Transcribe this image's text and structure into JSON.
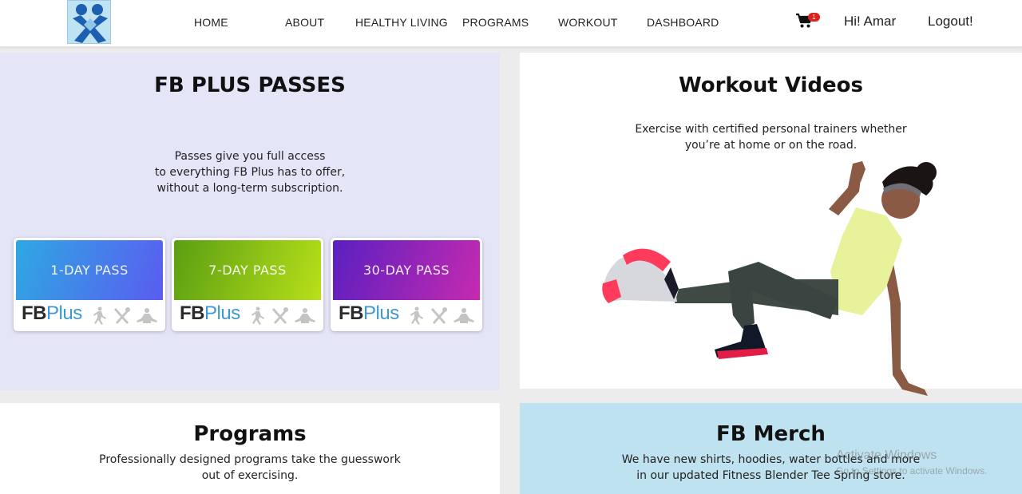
{
  "nav": {
    "links": [
      "HOME",
      "ABOUT",
      "HEALTHY LIVING",
      "PROGRAMS",
      "WORKOUT",
      "DASHBOARD"
    ],
    "cart_count": "1",
    "greeting": "Hi! Amar",
    "logout": "Logout!"
  },
  "passes": {
    "title": "FB PLUS PASSES",
    "description": [
      "Passes give you full access",
      "to everything FB Plus has to offer,",
      "without a long-term subscription."
    ],
    "cards": [
      {
        "label": "1-DAY PASS",
        "brand_fb": "FB",
        "brand_plus": "Plus",
        "gradient": [
          "#2ea8e3",
          "#5a5cf0"
        ]
      },
      {
        "label": "7-DAY PASS",
        "brand_fb": "FB",
        "brand_plus": "Plus",
        "gradient": [
          "#5a9e12",
          "#b8e01a"
        ]
      },
      {
        "label": "30-DAY PASS",
        "brand_fb": "FB",
        "brand_plus": "Plus",
        "gradient": [
          "#5a1fc0",
          "#c62ab0"
        ]
      }
    ]
  },
  "videos": {
    "title": "Workout Videos",
    "description": [
      "Exercise with certified personal trainers whether",
      "you’re at home or on the road."
    ]
  },
  "programs": {
    "title": "Programs",
    "description": [
      "Professionally designed programs take the guesswork",
      "out of exercising."
    ]
  },
  "merch": {
    "title": "FB Merch",
    "description": [
      "We have new shirts, hoodies, water bottles and more",
      "in our updated Fitness Blender Tee Spring store."
    ]
  },
  "watermark": {
    "title": "Activate Windows",
    "subtitle": "Go to Settings to activate Windows."
  },
  "colors": {
    "passes_bg": "#e5e5f8",
    "merch_bg": "#bfe2f0",
    "brand_blue": "#3f98d0",
    "badge_red": "#e0201b"
  },
  "icons": [
    "cart-icon",
    "runner-icon",
    "utensils-icon",
    "meditation-icon",
    "logo-icon"
  ]
}
